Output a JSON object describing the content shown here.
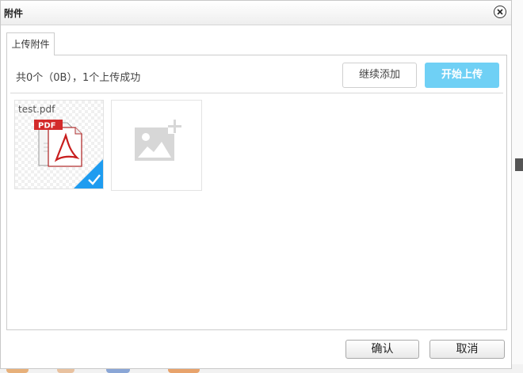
{
  "dialog": {
    "title": "附件",
    "close_icon": "close-icon"
  },
  "tabs": [
    {
      "label": "上传附件",
      "active": true
    }
  ],
  "upload": {
    "status_text": "共0个（0B），1个上传成功",
    "continue_label": "继续添加",
    "start_label": "开始上传",
    "start_color": "#6fd0f5"
  },
  "files": [
    {
      "name": "test.pdf",
      "icon": "pdf-file-icon",
      "uploaded": true,
      "badge_color": "#1e9cf0",
      "badge_icon": "checkmark-icon"
    }
  ],
  "add_tile": {
    "icon": "add-image-icon"
  },
  "footer": {
    "ok_label": "确认",
    "cancel_label": "取消"
  }
}
